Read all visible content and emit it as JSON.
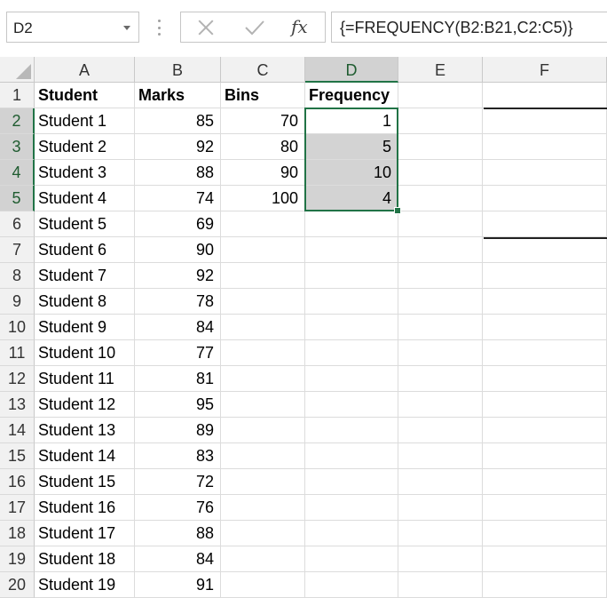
{
  "formula_bar": {
    "name_box": "D2",
    "cancel_icon": "cancel-x-icon",
    "enter_icon": "enter-check-icon",
    "fx_label": "fx",
    "formula": "{=FREQUENCY(B2:B21,C2:C5)}"
  },
  "sheet": {
    "columns": [
      "A",
      "B",
      "C",
      "D",
      "E",
      "F"
    ],
    "rows": [
      "1",
      "2",
      "3",
      "4",
      "5",
      "6",
      "7",
      "8",
      "9",
      "10",
      "11",
      "12",
      "13",
      "14",
      "15",
      "16",
      "17",
      "18",
      "19",
      "20"
    ],
    "selected_column": "D",
    "selected_rows": [
      "2",
      "3",
      "4",
      "5"
    ],
    "headers": {
      "student": "Student",
      "marks": "Marks",
      "bins": "Bins",
      "frequency": "Frequency"
    },
    "students": [
      "Student 1",
      "Student 2",
      "Student 3",
      "Student 4",
      "Student 5",
      "Student 6",
      "Student 7",
      "Student 8",
      "Student 9",
      "Student 10",
      "Student 11",
      "Student 12",
      "Student 13",
      "Student 14",
      "Student 15",
      "Student 16",
      "Student 17",
      "Student 18",
      "Student 19"
    ],
    "marks": [
      "85",
      "92",
      "88",
      "74",
      "69",
      "90",
      "92",
      "78",
      "84",
      "77",
      "81",
      "95",
      "89",
      "83",
      "72",
      "76",
      "88",
      "84",
      "91"
    ],
    "bins": [
      "70",
      "80",
      "90",
      "100"
    ],
    "frequency": [
      "1",
      "5",
      "10",
      "4"
    ]
  },
  "colors": {
    "selection": "#217346",
    "selected_fill": "#d3d3d3",
    "header_fill": "#f1f1f1"
  }
}
